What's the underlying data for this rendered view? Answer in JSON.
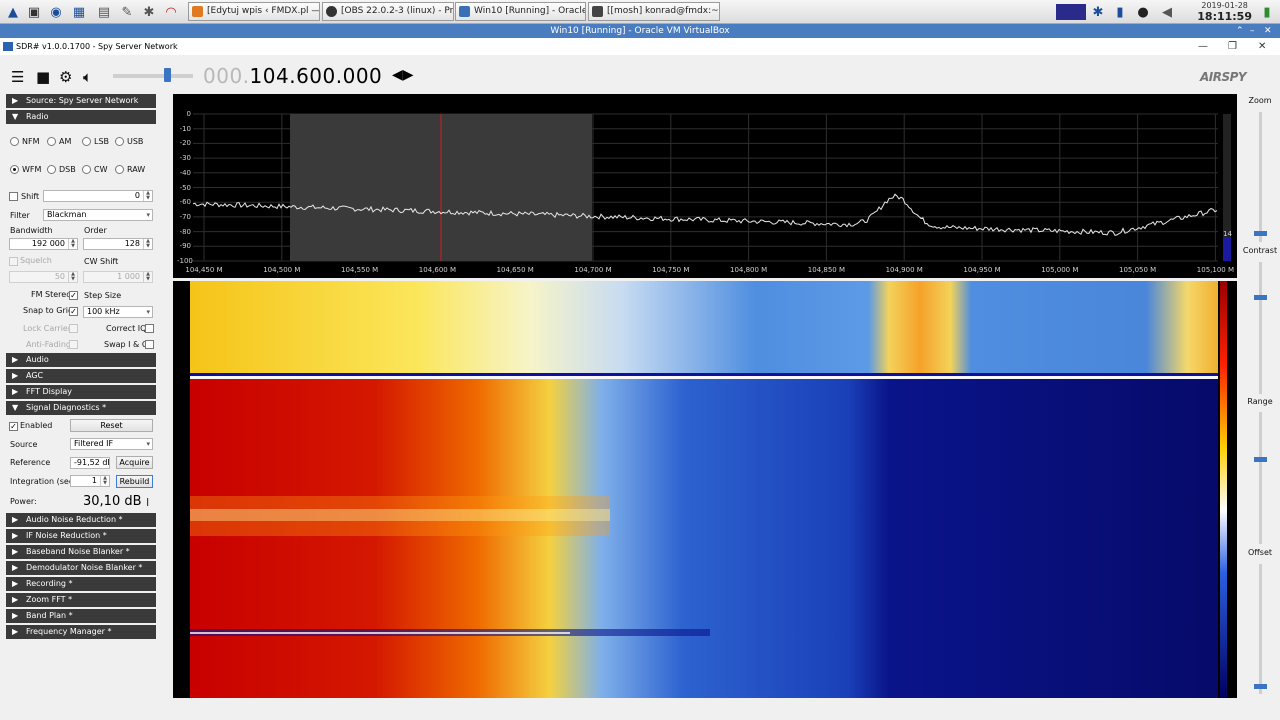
{
  "taskbar": {
    "tasks": [
      {
        "label": "[Edytuj wpis ‹ FMDX.pl —...",
        "icon": "firefox-icon"
      },
      {
        "label": "[OBS 22.0.2-3 (linux) - Pr...",
        "icon": "obs-icon"
      },
      {
        "label": "Win10 [Running] - Oracle...",
        "icon": "virtualbox-icon"
      },
      {
        "label": "[[mosh] konrad@fmdx:~]",
        "icon": "terminal-icon"
      }
    ],
    "date": "2019-01-28",
    "time": "18:11:59"
  },
  "vbox_title": "Win10 [Running] - Oracle VM VirtualBox",
  "app_title": "SDR# v1.0.0.1700 - Spy Server Network",
  "frequency": {
    "dim": "000.",
    "main": "104.600.000"
  },
  "brand": "AIRSPY",
  "panel": {
    "source_header": "Source: Spy Server Network",
    "radio_header": "Radio",
    "modes": [
      "NFM",
      "AM",
      "LSB",
      "USB",
      "WFM",
      "DSB",
      "CW",
      "RAW"
    ],
    "selected_mode": "WFM",
    "shift_label": "Shift",
    "shift_value": "0",
    "filter_label": "Filter",
    "filter_value": "Blackman",
    "bandwidth_label": "Bandwidth",
    "bandwidth_value": "192 000",
    "order_label": "Order",
    "order_value": "128",
    "squelch_label": "Squelch",
    "squelch_value": "50",
    "cwshift_label": "CW Shift",
    "cwshift_value": "1 000",
    "fmstereo_label": "FM Stereo",
    "stepsize_label": "Step Size",
    "snap_label": "Snap to Grid",
    "snap_value": "100 kHz",
    "lockcarrier_label": "Lock Carrier",
    "correctiq_label": "Correct IQ",
    "antifading_label": "Anti-Fading",
    "swapiq_label": "Swap I & Q",
    "audio_header": "Audio",
    "agc_header": "AGC",
    "fft_header": "FFT Display",
    "diag_header": "Signal Diagnostics *",
    "enabled_label": "Enabled",
    "reset_label": "Reset",
    "source_label": "Source",
    "source_value": "Filtered IF",
    "reference_label": "Reference",
    "reference_value": "-91,52 dB",
    "acquire_label": "Acquire",
    "integration_label": "Integration (sec)",
    "integration_value": "1",
    "rebuild_label": "Rebuild",
    "power_label": "Power:",
    "power_value": "30,10 dB",
    "plugins": [
      "Audio Noise Reduction *",
      "IF Noise Reduction *",
      "Baseband Noise Blanker *",
      "Demodulator Noise Blanker *",
      "Recording *",
      "Zoom FFT *",
      "Band Plan *",
      "Frequency Manager *"
    ]
  },
  "spectrum": {
    "y_ticks": [
      "0",
      "-10",
      "-20",
      "-30",
      "-40",
      "-50",
      "-60",
      "-70",
      "-80",
      "-90",
      "-100"
    ],
    "x_ticks": [
      "104,450 M",
      "104,500 M",
      "104,550 M",
      "104,600 M",
      "104,650 M",
      "104,700 M",
      "104,750 M",
      "104,800 M",
      "104,850 M",
      "104,900 M",
      "104,950 M",
      "105,000 M",
      "105,050 M",
      "105,100 M"
    ],
    "side_number": "14"
  },
  "right_controls": {
    "zoom_label": "Zoom",
    "contrast_label": "Contrast",
    "range_label": "Range",
    "offset_label": "Offset"
  },
  "colors": {
    "panel_header": "#3a3a3a",
    "accent": "#3a74c2",
    "spectrum_trace": "#e8e8e8",
    "tuning_line": "#d02020"
  }
}
